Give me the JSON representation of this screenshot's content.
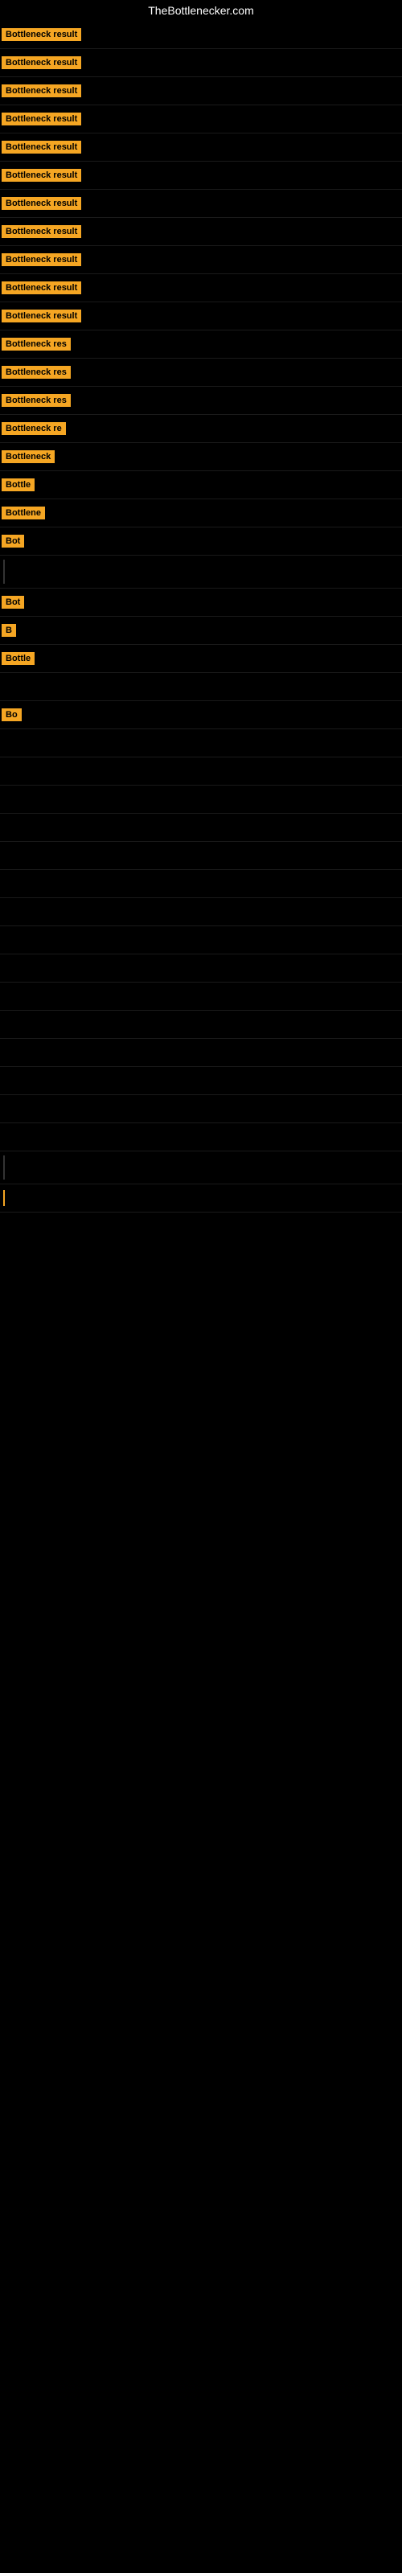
{
  "site": {
    "title": "TheBottlenecker.com"
  },
  "rows": [
    {
      "label": "Bottleneck result",
      "width": 120
    },
    {
      "label": "Bottleneck result",
      "width": 120
    },
    {
      "label": "Bottleneck result",
      "width": 120
    },
    {
      "label": "Bottleneck result",
      "width": 120
    },
    {
      "label": "Bottleneck result",
      "width": 120
    },
    {
      "label": "Bottleneck result",
      "width": 120
    },
    {
      "label": "Bottleneck result",
      "width": 120
    },
    {
      "label": "Bottleneck result",
      "width": 120
    },
    {
      "label": "Bottleneck result",
      "width": 120
    },
    {
      "label": "Bottleneck result",
      "width": 120
    },
    {
      "label": "Bottleneck result",
      "width": 115
    },
    {
      "label": "Bottleneck res",
      "width": 105
    },
    {
      "label": "Bottleneck res",
      "width": 100
    },
    {
      "label": "Bottleneck res",
      "width": 98
    },
    {
      "label": "Bottleneck re",
      "width": 90
    },
    {
      "label": "Bottleneck",
      "width": 75
    },
    {
      "label": "Bottle",
      "width": 52
    },
    {
      "label": "Bottlene",
      "width": 62
    },
    {
      "label": "Bot",
      "width": 35
    },
    {
      "label": "",
      "width": 0,
      "isLine": true
    },
    {
      "label": "Bot",
      "width": 35
    },
    {
      "label": "B",
      "width": 18
    },
    {
      "label": "Bottle",
      "width": 50
    },
    {
      "label": "",
      "width": 0,
      "isEmpty": true
    },
    {
      "label": "Bo",
      "width": 28
    },
    {
      "label": "",
      "width": 0,
      "isEmpty": true
    },
    {
      "label": "",
      "width": 0,
      "isEmpty": true
    },
    {
      "label": "",
      "width": 0,
      "isEmpty": true
    },
    {
      "label": "",
      "width": 0,
      "isEmpty": true
    },
    {
      "label": "",
      "width": 0,
      "isEmpty": true
    },
    {
      "label": "",
      "width": 0,
      "isEmpty": true
    },
    {
      "label": "",
      "width": 0,
      "isEmpty": true
    },
    {
      "label": "",
      "width": 0,
      "isEmpty": true
    },
    {
      "label": "",
      "width": 0,
      "isEmpty": true
    },
    {
      "label": "",
      "width": 0,
      "isEmpty": true
    },
    {
      "label": "",
      "width": 0,
      "isEmpty": true
    },
    {
      "label": "",
      "width": 0,
      "isEmpty": true
    },
    {
      "label": "",
      "width": 0,
      "isEmpty": true
    },
    {
      "label": "",
      "width": 0,
      "isEmpty": true
    },
    {
      "label": "",
      "width": 0,
      "isEmpty": true
    },
    {
      "label": "",
      "width": 0,
      "isLine": true
    },
    {
      "label": "",
      "width": 0,
      "isSmallLine": true
    }
  ]
}
